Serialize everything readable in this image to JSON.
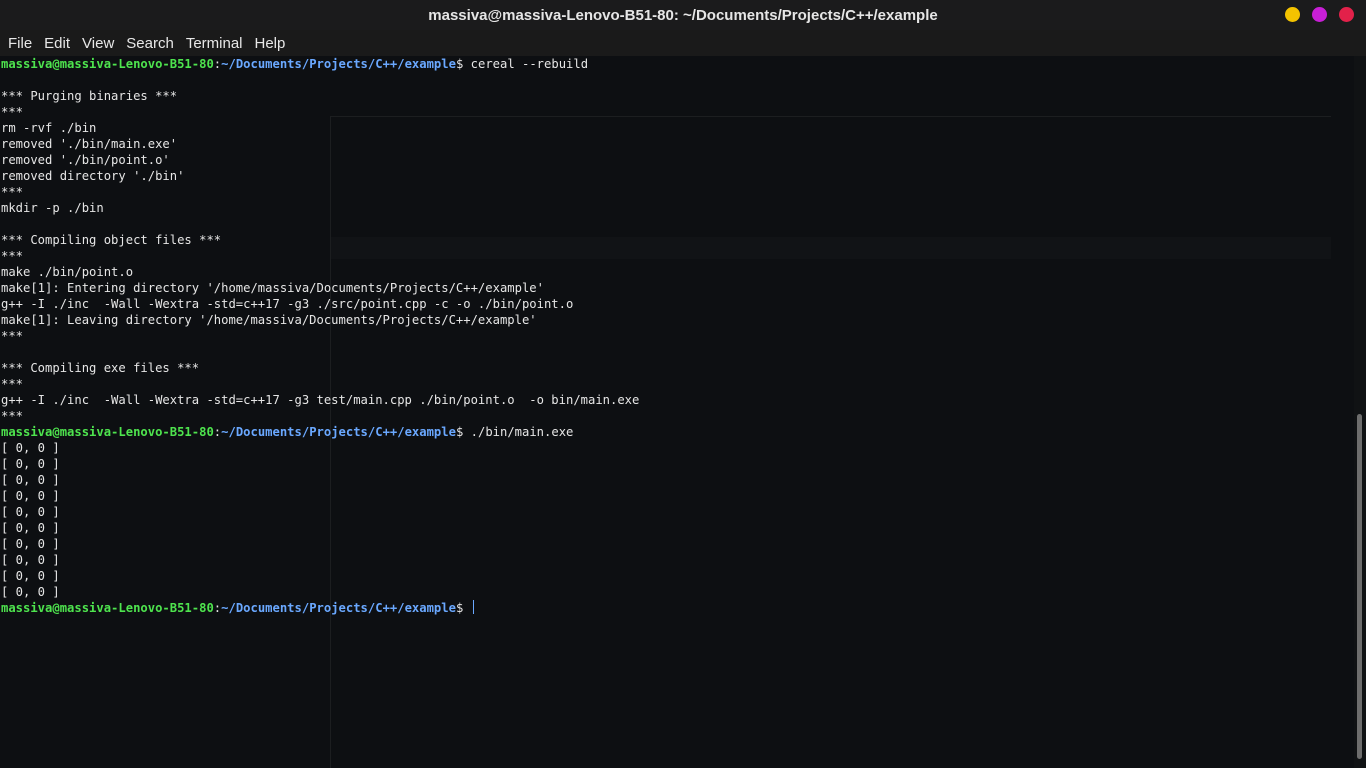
{
  "window": {
    "title": "massiva@massiva-Lenovo-B51-80: ~/Documents/Projects/C++/example",
    "controls": [
      {
        "name": "minimize",
        "color": "#f4c300"
      },
      {
        "name": "maximize",
        "color": "#c81fd6"
      },
      {
        "name": "close",
        "color": "#e2214a"
      }
    ]
  },
  "menu": [
    "File",
    "Edit",
    "View",
    "Search",
    "Terminal",
    "Help"
  ],
  "prompt": {
    "user": "massiva@massiva-Lenovo-B51-80",
    "colon": ":",
    "path": "~/Documents/Projects/C++/example",
    "symbol": "$ "
  },
  "output": [
    {
      "type": "prompt",
      "cmd": "cereal --rebuild"
    },
    {
      "type": "text",
      "text": ""
    },
    {
      "type": "text",
      "text": "*** Purging binaries ***"
    },
    {
      "type": "text",
      "text": "***"
    },
    {
      "type": "text",
      "text": "rm -rvf ./bin"
    },
    {
      "type": "text",
      "text": "removed './bin/main.exe'"
    },
    {
      "type": "text",
      "text": "removed './bin/point.o'"
    },
    {
      "type": "text",
      "text": "removed directory './bin'"
    },
    {
      "type": "text",
      "text": "***"
    },
    {
      "type": "text",
      "text": "mkdir -p ./bin"
    },
    {
      "type": "text",
      "text": ""
    },
    {
      "type": "text",
      "text": "*** Compiling object files ***"
    },
    {
      "type": "text",
      "text": "***"
    },
    {
      "type": "text",
      "text": "make ./bin/point.o"
    },
    {
      "type": "text",
      "text": "make[1]: Entering directory '/home/massiva/Documents/Projects/C++/example'"
    },
    {
      "type": "text",
      "text": "g++ -I ./inc  -Wall -Wextra -std=c++17 -g3 ./src/point.cpp -c -o ./bin/point.o"
    },
    {
      "type": "text",
      "text": "make[1]: Leaving directory '/home/massiva/Documents/Projects/C++/example'"
    },
    {
      "type": "text",
      "text": "***"
    },
    {
      "type": "text",
      "text": ""
    },
    {
      "type": "text",
      "text": "*** Compiling exe files ***"
    },
    {
      "type": "text",
      "text": "***"
    },
    {
      "type": "text",
      "text": "g++ -I ./inc  -Wall -Wextra -std=c++17 -g3 test/main.cpp ./bin/point.o  -o bin/main.exe"
    },
    {
      "type": "text",
      "text": "***"
    },
    {
      "type": "prompt",
      "cmd": "./bin/main.exe"
    },
    {
      "type": "text",
      "text": "[ 0, 0 ]"
    },
    {
      "type": "text",
      "text": "[ 0, 0 ]"
    },
    {
      "type": "text",
      "text": "[ 0, 0 ]"
    },
    {
      "type": "text",
      "text": "[ 0, 0 ]"
    },
    {
      "type": "text",
      "text": "[ 0, 0 ]"
    },
    {
      "type": "text",
      "text": "[ 0, 0 ]"
    },
    {
      "type": "text",
      "text": "[ 0, 0 ]"
    },
    {
      "type": "text",
      "text": "[ 0, 0 ]"
    },
    {
      "type": "text",
      "text": "[ 0, 0 ]"
    },
    {
      "type": "text",
      "text": "[ 0, 0 ]"
    },
    {
      "type": "prompt",
      "cmd": "",
      "cursor": true
    }
  ]
}
